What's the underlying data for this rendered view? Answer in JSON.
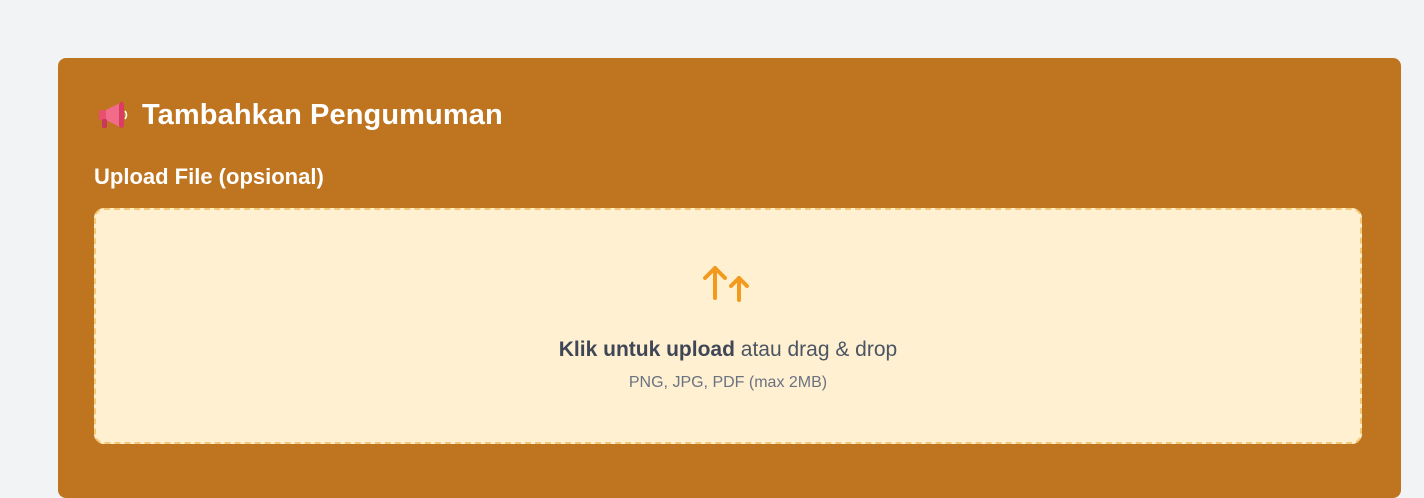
{
  "form": {
    "title_icon": "megaphone-icon",
    "title": "Tambahkan Pengumuman",
    "upload_label": "Upload File (opsional)",
    "dropzone": {
      "icon": "upload-arrows-icon",
      "action_text": "Klik untuk upload",
      "rest_text": " atau drag & drop",
      "hint": "PNG, JPG, PDF (max 2MB)"
    }
  },
  "colors": {
    "page_background": "#f2f3f5",
    "card_background": "#bf7420",
    "dropzone_background": "#fff0d2",
    "dropzone_border": "#f4c876",
    "upload_icon": "#f39a1e",
    "title_text": "#ffffff"
  }
}
